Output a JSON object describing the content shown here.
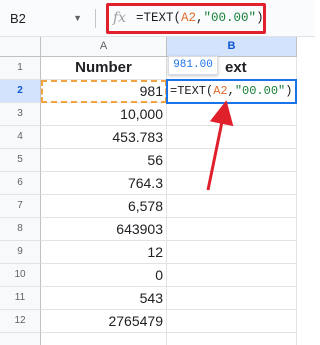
{
  "formula_bar": {
    "name_box": "B2",
    "fx_label": "fx",
    "formula_prefix": "=TEXT(",
    "formula_ref": "A2",
    "formula_sep": ",",
    "formula_str": "\"00.00\"",
    "formula_suffix": ")"
  },
  "columns": [
    {
      "label": "A"
    },
    {
      "label": "B"
    }
  ],
  "header_row": {
    "row": "1",
    "a": "Number",
    "b": "ext"
  },
  "rows": [
    {
      "row": "2",
      "value": "981"
    },
    {
      "row": "3",
      "value": "10,000"
    },
    {
      "row": "4",
      "value": "453.783"
    },
    {
      "row": "5",
      "value": "56"
    },
    {
      "row": "6",
      "value": "764.3"
    },
    {
      "row": "7",
      "value": "6,578"
    },
    {
      "row": "8",
      "value": "643903"
    },
    {
      "row": "9",
      "value": "12"
    },
    {
      "row": "10",
      "value": "0"
    },
    {
      "row": "11",
      "value": "543"
    },
    {
      "row": "12",
      "value": "2765479"
    }
  ],
  "preview_tooltip": "981.00",
  "edit_cell": {
    "prefix": "=TEXT(",
    "ref": "A2",
    "sep": ",",
    "str": "\"00.00\"",
    "suffix": ")"
  },
  "colors": {
    "highlight_red": "#e0202a",
    "selection_blue": "#1a73e8",
    "ref_orange": "#e06b2c",
    "string_green": "#188038"
  }
}
